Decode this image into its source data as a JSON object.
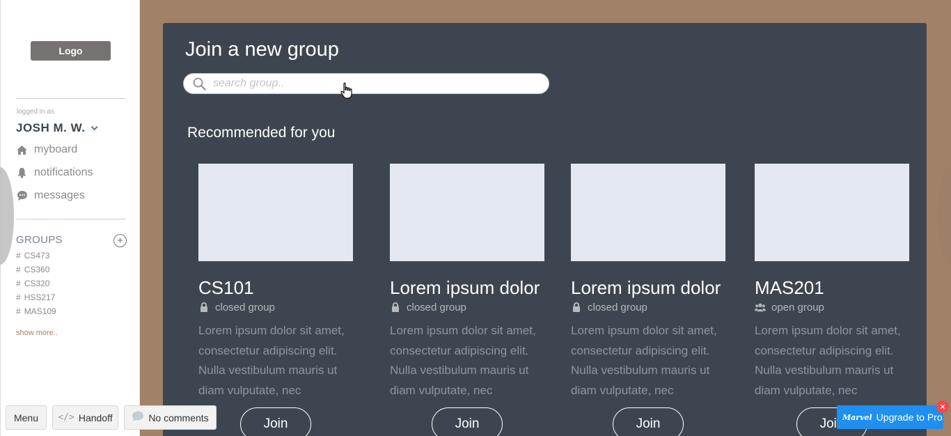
{
  "sidebar": {
    "logo": "Logo",
    "logged_in_label": "logged in as",
    "username": "JOSH M. W.",
    "nav": [
      {
        "label": "myboard",
        "icon": "home-icon"
      },
      {
        "label": "notifications",
        "icon": "bell-icon"
      },
      {
        "label": "messages",
        "icon": "chat-icon"
      }
    ],
    "groups_heading": "GROUPS",
    "groups": [
      "CS473",
      "CS360",
      "CS320",
      "HSS217",
      "MAS109"
    ],
    "show_more": "show more.."
  },
  "main": {
    "title": "Join a new group",
    "search_placeholder": "search group..",
    "recommended_heading": "Recommended for you",
    "join_label": "Join",
    "cards": [
      {
        "name": "CS101",
        "type": "closed group",
        "type_icon": "lock-icon",
        "description": "Lorem ipsum dolor sit amet, consectetur adipiscing elit. Nulla vestibulum mauris ut diam vulputate, nec"
      },
      {
        "name": "Lorem ipsum dolor",
        "type": "closed group",
        "type_icon": "lock-icon",
        "description": "Lorem ipsum dolor sit amet, consectetur adipiscing elit. Nulla vestibulum mauris ut diam vulputate, nec"
      },
      {
        "name": "Lorem ipsum dolor",
        "type": "closed group",
        "type_icon": "lock-icon",
        "description": "Lorem ipsum dolor sit amet, consectetur adipiscing elit. Nulla vestibulum mauris ut diam vulputate, nec"
      },
      {
        "name": "MAS201",
        "type": "open group",
        "type_icon": "users-icon",
        "description": "Lorem ipsum dolor sit amet, consectetur adipiscing elit. Nulla vestibulum mauris ut diam vulputate, nec"
      }
    ]
  },
  "toolbar": {
    "menu": "Menu",
    "handoff": "Handoff",
    "comments": "No comments",
    "upgrade_brand": "Marvel",
    "upgrade": "Upgrade to Pro"
  },
  "colors": {
    "background": "#a28169",
    "panel": "#3d4650",
    "accent": "#1f8ff0",
    "show_more": "#b77a5e"
  }
}
